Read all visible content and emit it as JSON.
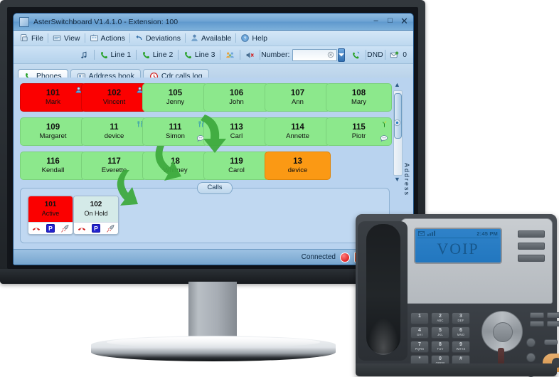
{
  "window": {
    "title": "AsterSwitchboard V1.4.1.0 - Extension: 100",
    "icon": "app-icon",
    "minimize_label": "–",
    "maximize_label": "□",
    "close_label": "✕"
  },
  "menu": {
    "items": [
      {
        "label": "File",
        "icon": "file-icon"
      },
      {
        "label": "View",
        "icon": "view-icon"
      },
      {
        "label": "Actions",
        "icon": "actions-icon"
      },
      {
        "label": "Deviations",
        "icon": "deviations-icon"
      },
      {
        "label": "Available",
        "icon": "available-person-icon"
      },
      {
        "label": "Help",
        "icon": "help-icon"
      }
    ]
  },
  "toolbar": {
    "music_icon": "music-note-icon",
    "lines": [
      {
        "label": "Line 1",
        "icon": "phone-handset-icon"
      },
      {
        "label": "Line 2",
        "icon": "phone-handset-icon"
      },
      {
        "label": "Line 3",
        "icon": "phone-handset-icon"
      }
    ],
    "conference_icon": "conference-group-icon",
    "mute_icon": "speaker-mute-icon",
    "number_label": "Number:",
    "number_value": "",
    "number_placeholder": "",
    "clear_icon": "clear-circle-icon",
    "dropdown_icon": "chevron-down-icon",
    "dial_icon": "dial-phone-icon",
    "dnd_label": "DND",
    "mail_icon": "voicemail-envelope-icon",
    "mail_count": "0"
  },
  "tabs": [
    {
      "label": "Phones",
      "icon": "phone-handset-icon",
      "active": true
    },
    {
      "label": "Address book",
      "icon": "contact-card-icon",
      "active": false
    },
    {
      "label": "Cdr calls log",
      "icon": "clock-log-icon",
      "active": false
    }
  ],
  "phones": [
    {
      "number": "101",
      "name": "Mark",
      "color": "red",
      "icons": [
        "person-icon"
      ]
    },
    {
      "number": "102",
      "name": "Vincent",
      "color": "red",
      "icons": [
        "person-icon"
      ]
    },
    {
      "number": "105",
      "name": "Jenny",
      "color": "green",
      "icons": []
    },
    {
      "number": "106",
      "name": "John",
      "color": "green",
      "icons": []
    },
    {
      "number": "107",
      "name": "Ann",
      "color": "green",
      "icons": []
    },
    {
      "number": "108",
      "name": "Mary",
      "color": "green",
      "icons": []
    },
    {
      "number": "109",
      "name": "Margaret",
      "color": "green",
      "icons": []
    },
    {
      "number": "11",
      "name": "device",
      "color": "green",
      "icons": [
        "cutlery-icon"
      ]
    },
    {
      "number": "111",
      "name": "Simon",
      "color": "green",
      "icons": [
        "cutlery-icon",
        "chat-bubble-icon"
      ]
    },
    {
      "number": "113",
      "name": "Carl",
      "color": "green",
      "icons": []
    },
    {
      "number": "114",
      "name": "Annette",
      "color": "green",
      "icons": []
    },
    {
      "number": "115",
      "name": "Piotr",
      "color": "green",
      "icons": [
        "sprout-icon",
        "chat-bubble-icon"
      ]
    },
    {
      "number": "116",
      "name": "Kendall",
      "color": "green",
      "icons": []
    },
    {
      "number": "117",
      "name": "Everette",
      "color": "green",
      "icons": []
    },
    {
      "number": "18",
      "name": "Whitney",
      "color": "green",
      "icons": []
    },
    {
      "number": "119",
      "name": "Carol",
      "color": "green",
      "icons": []
    },
    {
      "number": "13",
      "name": "device",
      "color": "orange",
      "icons": []
    }
  ],
  "sidebar": {
    "vertical_label": "Address",
    "scroll_up_icon": "triangle-up-icon",
    "scroll_down_icon": "triangle-down-icon",
    "mini_icon": "record-circle-icon"
  },
  "calls": {
    "panel_label": "Calls",
    "items": [
      {
        "number": "101",
        "status": "Active",
        "color": "red",
        "actions": [
          "hangup-icon",
          "park-icon",
          "transfer-icon"
        ]
      },
      {
        "number": "102",
        "status": "On Hold",
        "color": "pale",
        "actions": [
          "hangup-icon",
          "park-icon",
          "transfer-icon"
        ]
      }
    ],
    "park_label": "P"
  },
  "statusbar": {
    "connection_label": "Connected",
    "record_icon": "record-dot-icon",
    "stop_icon": "stop-square-icon",
    "theme_value": "DeepBlue"
  },
  "voip_phone": {
    "lcd": {
      "main_text": "VOIP",
      "time": "2:45 PM",
      "envelope_icon": "envelope-icon",
      "signal_icon": "signal-bars-icon"
    },
    "keypad": [
      {
        "digit": "1",
        "letters": ""
      },
      {
        "digit": "2",
        "letters": "ABC"
      },
      {
        "digit": "3",
        "letters": "DEF"
      },
      {
        "digit": "4",
        "letters": "GHI"
      },
      {
        "digit": "5",
        "letters": "JKL"
      },
      {
        "digit": "6",
        "letters": "MNO"
      },
      {
        "digit": "7",
        "letters": "PQRS"
      },
      {
        "digit": "8",
        "letters": "TUV"
      },
      {
        "digit": "9",
        "letters": "WXYZ"
      },
      {
        "digit": "*",
        "letters": ""
      },
      {
        "digit": "0",
        "letters": "OPER"
      },
      {
        "digit": "#",
        "letters": ""
      }
    ]
  },
  "colors": {
    "cell_green": "#8ce88c",
    "cell_red": "#fb0000",
    "cell_orange": "#fb9914",
    "app_background": "#b9d3ef",
    "arrow_green": "#3faa3f"
  }
}
